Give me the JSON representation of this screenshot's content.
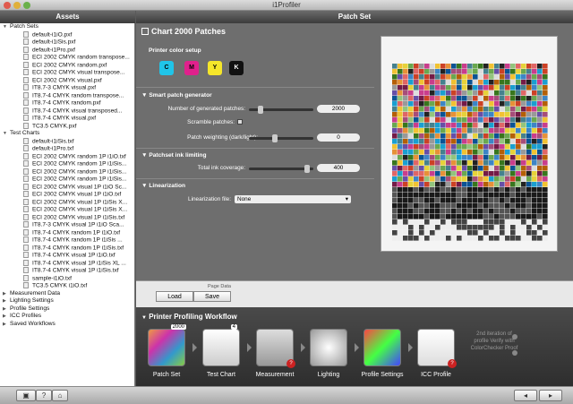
{
  "window": {
    "title": "i1Profiler"
  },
  "sidebar": {
    "header": "Assets",
    "tree": [
      {
        "label": "Patch Sets",
        "level": 0,
        "open": true
      },
      {
        "label": "default-i1iO.pxf",
        "level": 1
      },
      {
        "label": "default-i1iSis.pxf",
        "level": 1
      },
      {
        "label": "default-i1Pro.pxf",
        "level": 1
      },
      {
        "label": "ECI 2002 CMYK random transpose...",
        "level": 1
      },
      {
        "label": "ECI 2002 CMYK random.pxf",
        "level": 1
      },
      {
        "label": "ECI 2002 CMYK visual transpose...",
        "level": 1
      },
      {
        "label": "ECI 2002 CMYK visual.pxf",
        "level": 1
      },
      {
        "label": "IT8.7-3 CMYK visual.pxf",
        "level": 1
      },
      {
        "label": "IT8.7-4 CMYK random transpose...",
        "level": 1
      },
      {
        "label": "IT8.7-4 CMYK random.pxf",
        "level": 1
      },
      {
        "label": "IT8.7-4 CMYK visual transposed...",
        "level": 1
      },
      {
        "label": "IT8.7-4 CMYK visual.pxf",
        "level": 1
      },
      {
        "label": "TC3.5 CMYK.pxf",
        "level": 1
      },
      {
        "label": "Test Charts",
        "level": 0,
        "open": true
      },
      {
        "label": "default-i1iSis.txf",
        "level": 1
      },
      {
        "label": "default-i1Pro.txf",
        "level": 1
      },
      {
        "label": "ECI 2002 CMYK random 1P i1iO.txf",
        "level": 1
      },
      {
        "label": "ECI 2002 CMYK random 1P i1iSis...",
        "level": 1
      },
      {
        "label": "ECI 2002 CMYK random 1P i1iSis...",
        "level": 1
      },
      {
        "label": "ECI 2002 CMYK random 1P i1iSis...",
        "level": 1
      },
      {
        "label": "ECI 2002 CMYK visual 1P i1iO Sc...",
        "level": 1
      },
      {
        "label": "ECI 2002 CMYK visual 1P i1iO.txf",
        "level": 1
      },
      {
        "label": "ECI 2002 CMYK visual 1P i1iSis X...",
        "level": 1
      },
      {
        "label": "ECI 2002 CMYK visual 1P i1iSis X...",
        "level": 1
      },
      {
        "label": "ECI 2002 CMYK visual 1P i1iSis.txf",
        "level": 1
      },
      {
        "label": "IT8.7-3 CMYK visual 1P i1iO Sca...",
        "level": 1
      },
      {
        "label": "IT8.7-4 CMYK random 1P i1iO.txf",
        "level": 1
      },
      {
        "label": "IT8.7-4 CMYK random 1P i1iSis ...",
        "level": 1
      },
      {
        "label": "IT8.7-4 CMYK random 1P i1iSis.txf",
        "level": 1
      },
      {
        "label": "IT8.7-4 CMYK visual 1P i1iO.txf",
        "level": 1
      },
      {
        "label": "IT8.7-4 CMYK visual 1P i1iSis XL ...",
        "level": 1
      },
      {
        "label": "IT8.7-4 CMYK visual 1P i1iSis.txf",
        "level": 1
      },
      {
        "label": "sample-i1iO.txf",
        "level": 1
      },
      {
        "label": "TC3.5 CMYK i1iO.txf",
        "level": 1
      },
      {
        "label": "Measurement Data",
        "level": 0,
        "open": false
      },
      {
        "label": "Lighting Settings",
        "level": 0,
        "open": false
      },
      {
        "label": "Profile Settings",
        "level": 0,
        "open": false
      },
      {
        "label": "ICC Profiles",
        "level": 0,
        "open": false
      },
      {
        "label": "Saved Workflows",
        "level": 0,
        "open": false
      }
    ]
  },
  "main": {
    "header": "Patch Set",
    "title": "Chart 2000 Patches",
    "printer_setup_label": "Printer color setup",
    "inks": [
      {
        "label": "C",
        "color": "#20c4e8"
      },
      {
        "label": "M",
        "color": "#e0208c"
      },
      {
        "label": "Y",
        "color": "#f5e62a"
      },
      {
        "label": "K",
        "color": "#111111"
      }
    ],
    "smart": {
      "header": "Smart patch generator",
      "num_label": "Number of generated patches:",
      "num_value": "2000",
      "scramble_label": "Scramble patches:",
      "weight_label": "Patch weighting (dark/light):",
      "weight_value": "0"
    },
    "ink_limit": {
      "header": "Patchset ink limiting",
      "total_label": "Total ink coverage:",
      "total_value": "400"
    },
    "linear": {
      "header": "Linearization",
      "file_label": "Linearization file:",
      "file_value": "None"
    },
    "page_data": {
      "label": "Page Data",
      "load": "Load",
      "save": "Save"
    }
  },
  "workflow": {
    "header": "Printer Profiling Workflow",
    "steps": [
      {
        "label": "Patch Set",
        "badge": "2000"
      },
      {
        "label": "Test Chart",
        "badge": "4"
      },
      {
        "label": "Measurement"
      },
      {
        "label": "Lighting"
      },
      {
        "label": "Profile Settings"
      },
      {
        "label": "ICC Profile"
      }
    ],
    "note": "2nd iteration of profile Verify with ColorChecker Proof"
  },
  "bottom": {
    "b1": "▣",
    "b2": "?",
    "b3": "⌂"
  }
}
